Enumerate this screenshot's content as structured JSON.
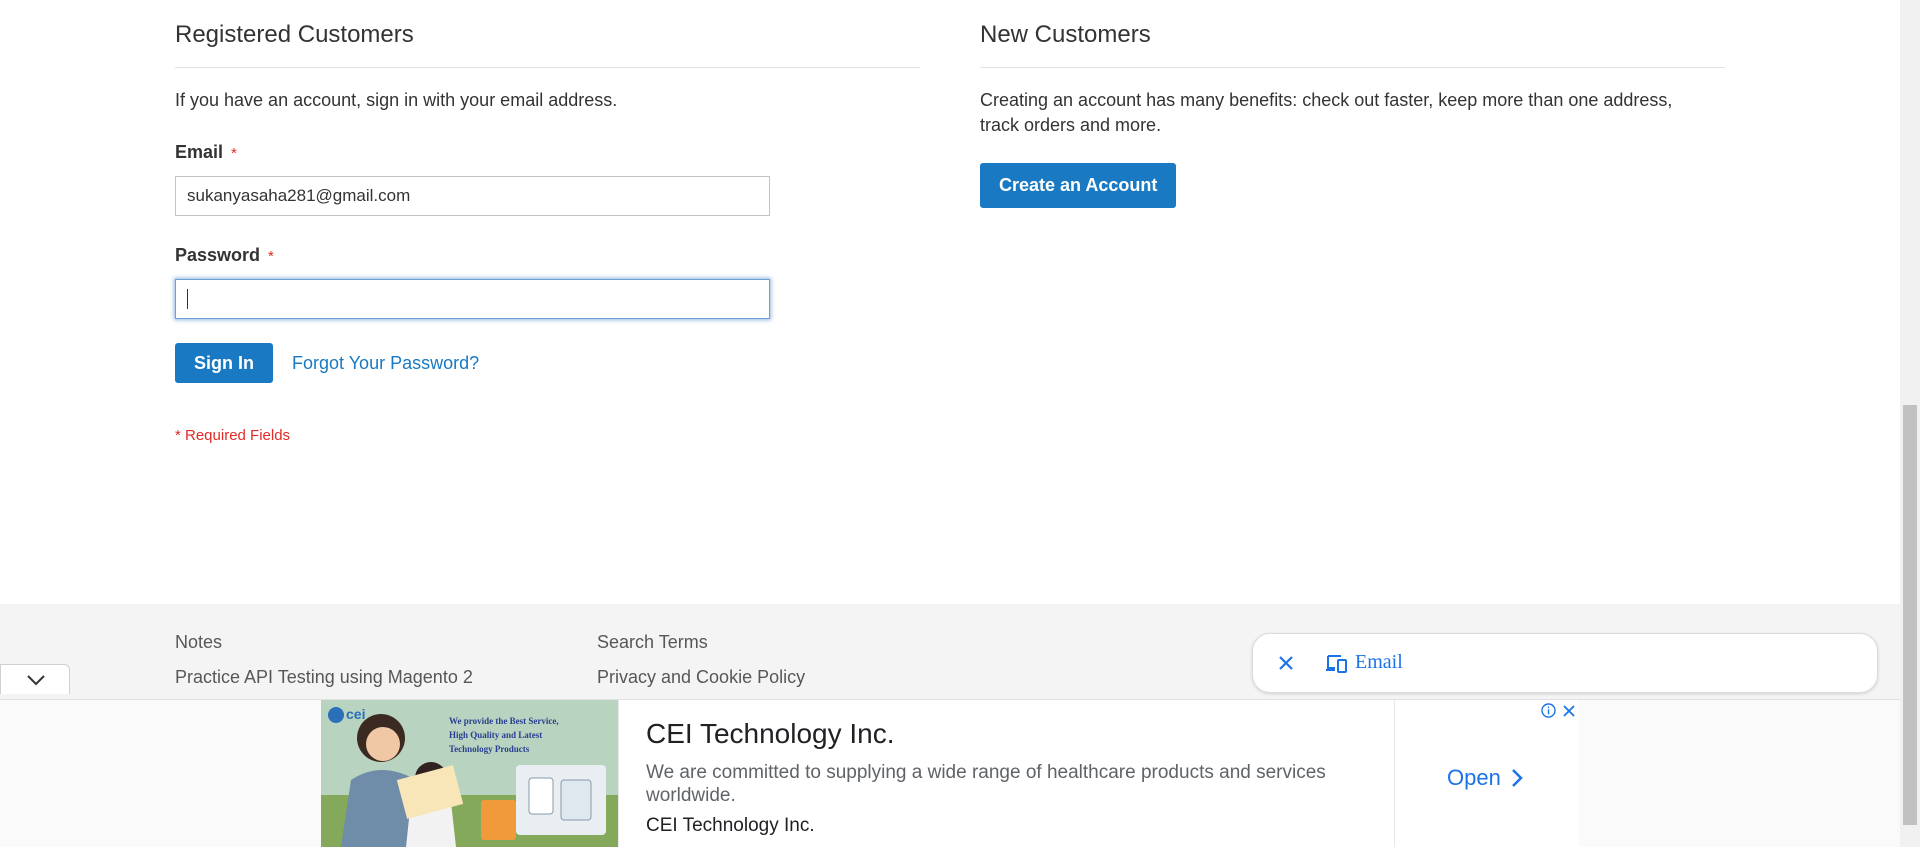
{
  "registered": {
    "title": "Registered Customers",
    "intro": "If you have an account, sign in with your email address.",
    "email_label": "Email",
    "email_value": "sukanyasaha281@gmail.com",
    "password_label": "Password",
    "password_value": "",
    "required_star": "*",
    "sign_in_label": "Sign In",
    "forgot_label": "Forgot Your Password?",
    "required_note": "* Required Fields"
  },
  "new_customers": {
    "title": "New Customers",
    "intro": "Creating an account has many benefits: check out faster, keep more than one address, track orders and more.",
    "create_label": "Create an Account"
  },
  "footer": {
    "links_col1": [
      "Notes",
      "Practice API Testing using Magento 2"
    ],
    "links_col2": [
      "Search Terms",
      "Privacy and Cookie Policy"
    ]
  },
  "email_chip": {
    "label": "Email",
    "close_icon": "close-icon",
    "device_icon": "devices-icon"
  },
  "ad": {
    "title": "CEI Technology Inc.",
    "description": "We are committed to supplying a wide range of healthcare products and services worldwide.",
    "brand": "CEI Technology Inc.",
    "open_label": "Open",
    "image_logo": "cei",
    "image_tagline": "We provide the Best Service, High Quality and Latest Technology Products"
  },
  "colors": {
    "primary": "#1979c3",
    "required": "#e02b27",
    "ad_link": "#1a73e8"
  }
}
